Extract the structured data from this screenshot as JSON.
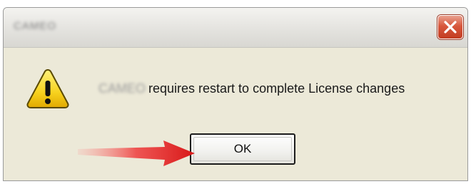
{
  "window": {
    "title": "CAMEO"
  },
  "message": {
    "app_name": "CAMEO",
    "text": "requires restart to complete License changes"
  },
  "buttons": {
    "ok_label": "OK",
    "close_icon": "close-icon"
  },
  "icons": {
    "warning": "warning-icon"
  },
  "colors": {
    "dialog_bg": "#ece9d8",
    "close_button": "#d8583d",
    "warning_yellow": "#f7d21e",
    "annotation_arrow": "#e02020"
  }
}
